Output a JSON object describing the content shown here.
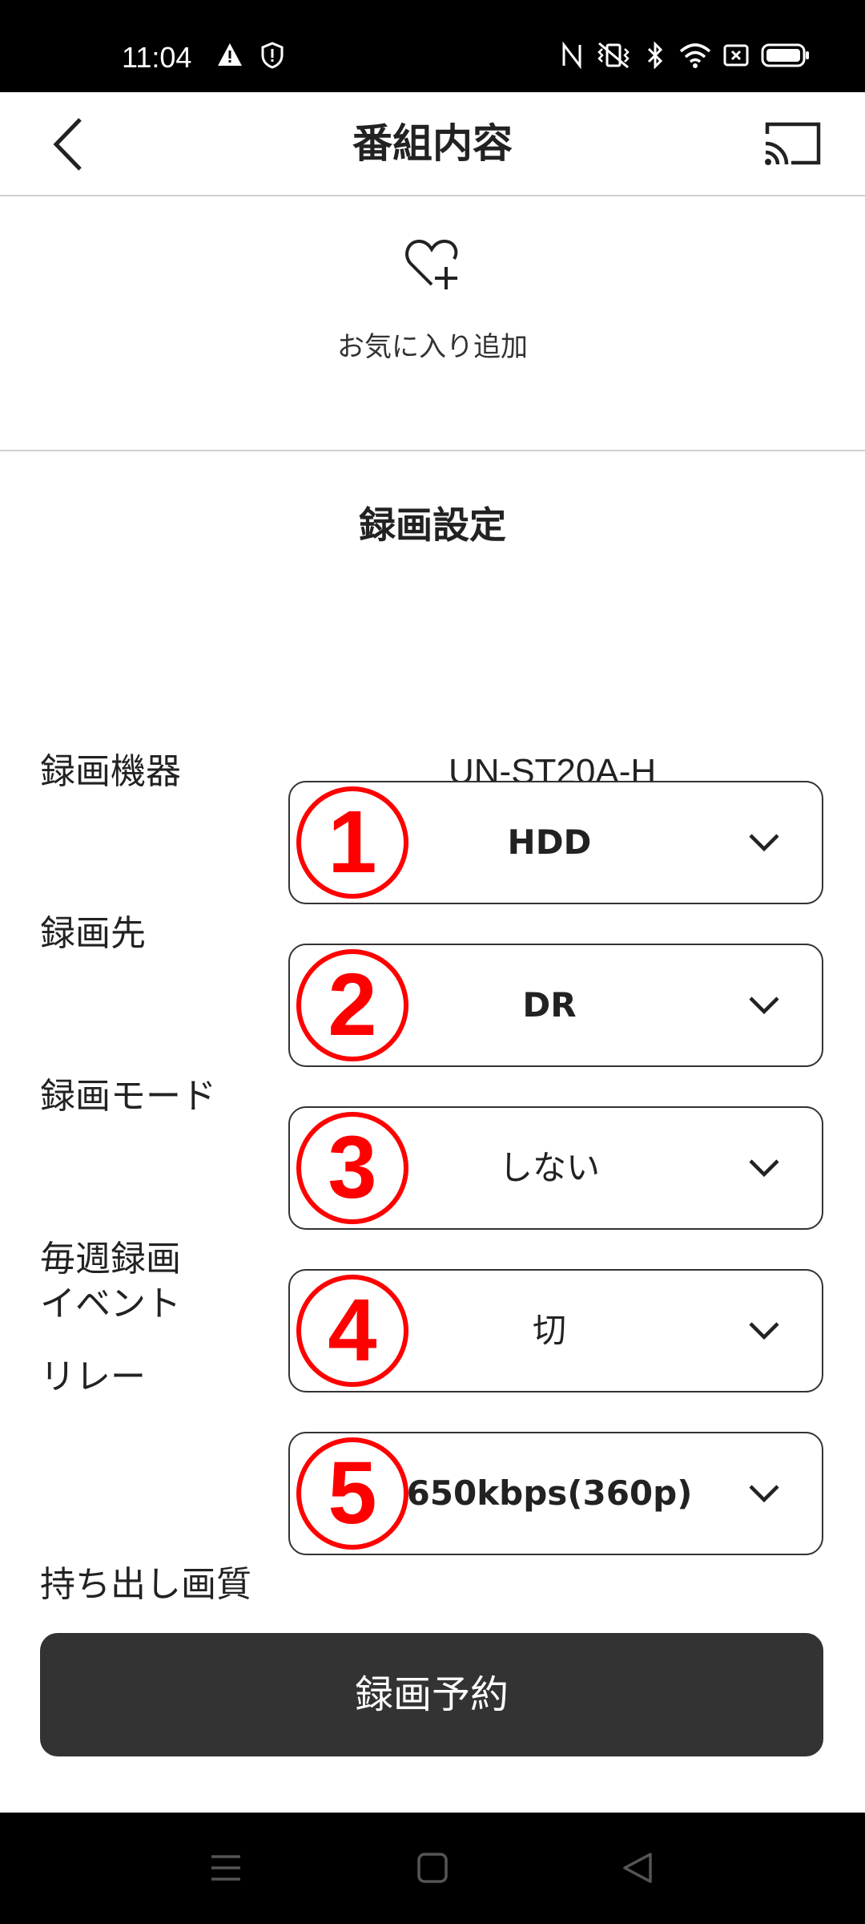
{
  "status_bar": {
    "time": "11:04",
    "icons": [
      "warning-icon",
      "shield-icon",
      "nfc-icon",
      "vibrate-icon",
      "bluetooth-icon",
      "wifi-icon",
      "sim-x-icon",
      "battery-icon"
    ]
  },
  "header": {
    "title": "番組内容",
    "back_icon": "chevron-left-icon",
    "cast_icon": "cast-icon"
  },
  "favorite": {
    "icon": "heart-plus-icon",
    "label": "お気に入り追加"
  },
  "recording": {
    "section_title": "録画設定",
    "device_label": "録画機器",
    "device_value": "UN-ST20A-H",
    "settings": [
      {
        "label": "録画先",
        "value": "HDD",
        "marker": "1"
      },
      {
        "label": "録画モード",
        "value": "DR",
        "marker": "2"
      },
      {
        "label": "毎週録画",
        "value": "しない",
        "marker": "3"
      },
      {
        "label_line1": "イベント",
        "label_line2": "リレー",
        "value": "切",
        "marker": "4"
      },
      {
        "label": "持ち出し画質",
        "value": "650kbps(360p)",
        "marker": "5"
      }
    ],
    "reserve_button": "録画予約"
  },
  "nav_bar": {
    "icons": [
      "menu-icon",
      "home-icon",
      "back-triangle-icon"
    ]
  },
  "colors": {
    "button_bg": "#333333",
    "marker": "#ff0000",
    "divider": "#cfcfcf"
  }
}
